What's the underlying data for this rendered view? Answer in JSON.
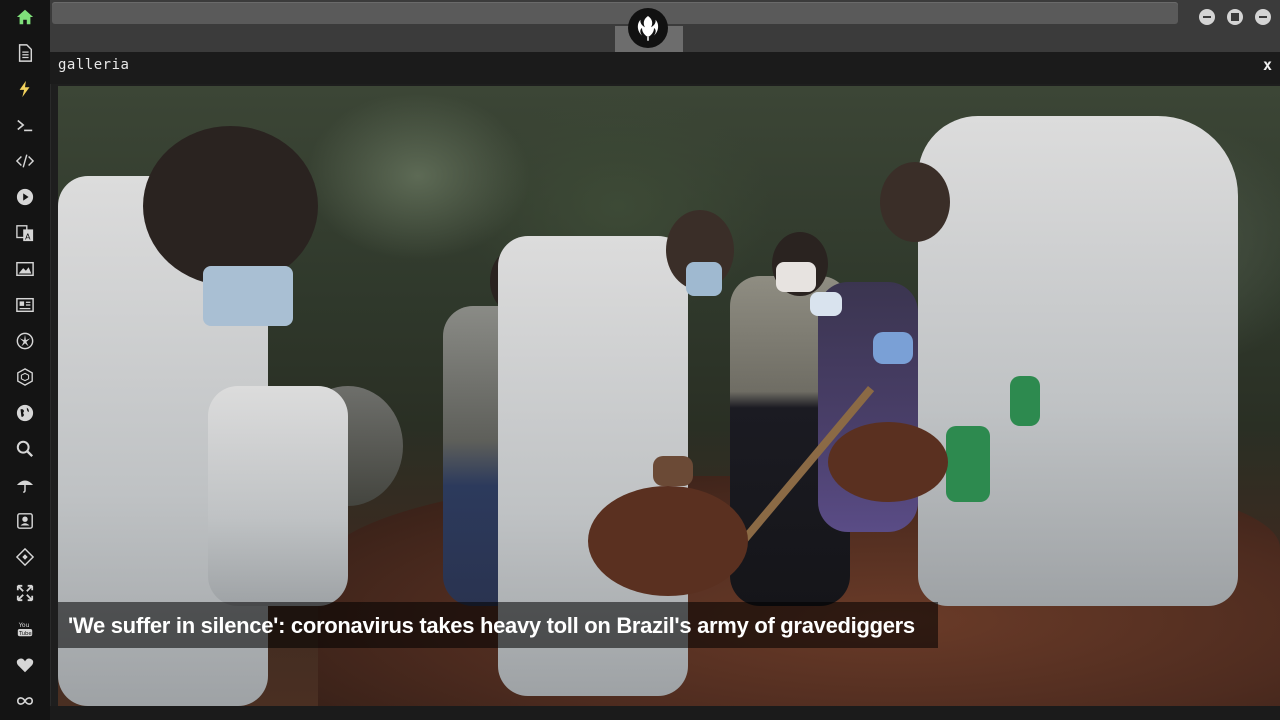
{
  "sidebar": {
    "icons": [
      {
        "name": "home-icon",
        "glyph": "⌂",
        "color": "#7fe07a"
      },
      {
        "name": "document-icon",
        "glyph": ""
      },
      {
        "name": "bolt-icon",
        "glyph": "ϟ",
        "color": "#f2d25c"
      },
      {
        "name": "terminal-icon",
        "glyph": ">_"
      },
      {
        "name": "code-icon",
        "glyph": "</>"
      },
      {
        "name": "play-icon",
        "glyph": ""
      },
      {
        "name": "translate-icon",
        "glyph": ""
      },
      {
        "name": "image-icon",
        "glyph": ""
      },
      {
        "name": "newspaper-icon",
        "glyph": ""
      },
      {
        "name": "rebel-icon",
        "glyph": "✵"
      },
      {
        "name": "hexagon-icon",
        "glyph": "⬡"
      },
      {
        "name": "globe-icon",
        "glyph": ""
      },
      {
        "name": "search-icon",
        "glyph": ""
      },
      {
        "name": "umbrella-icon",
        "glyph": "☂"
      },
      {
        "name": "contact-icon",
        "glyph": ""
      },
      {
        "name": "git-icon",
        "glyph": "◈"
      },
      {
        "name": "expand-icon",
        "glyph": "✛"
      },
      {
        "name": "youtube-icon",
        "glyph": "You Tube"
      },
      {
        "name": "heart-icon",
        "glyph": "♥"
      },
      {
        "name": "infinity-icon",
        "glyph": "∞"
      }
    ]
  },
  "window": {
    "title": "galleria",
    "close_label": "x"
  },
  "gallery": {
    "caption": "'We suffer in silence': coronavirus takes heavy toll on Brazil's army of gravediggers"
  },
  "colors": {
    "sidebar_bg": "#141414",
    "topbar_bg": "#3b3b3b",
    "accent_home": "#7fe07a",
    "accent_bolt": "#f2d25c"
  }
}
